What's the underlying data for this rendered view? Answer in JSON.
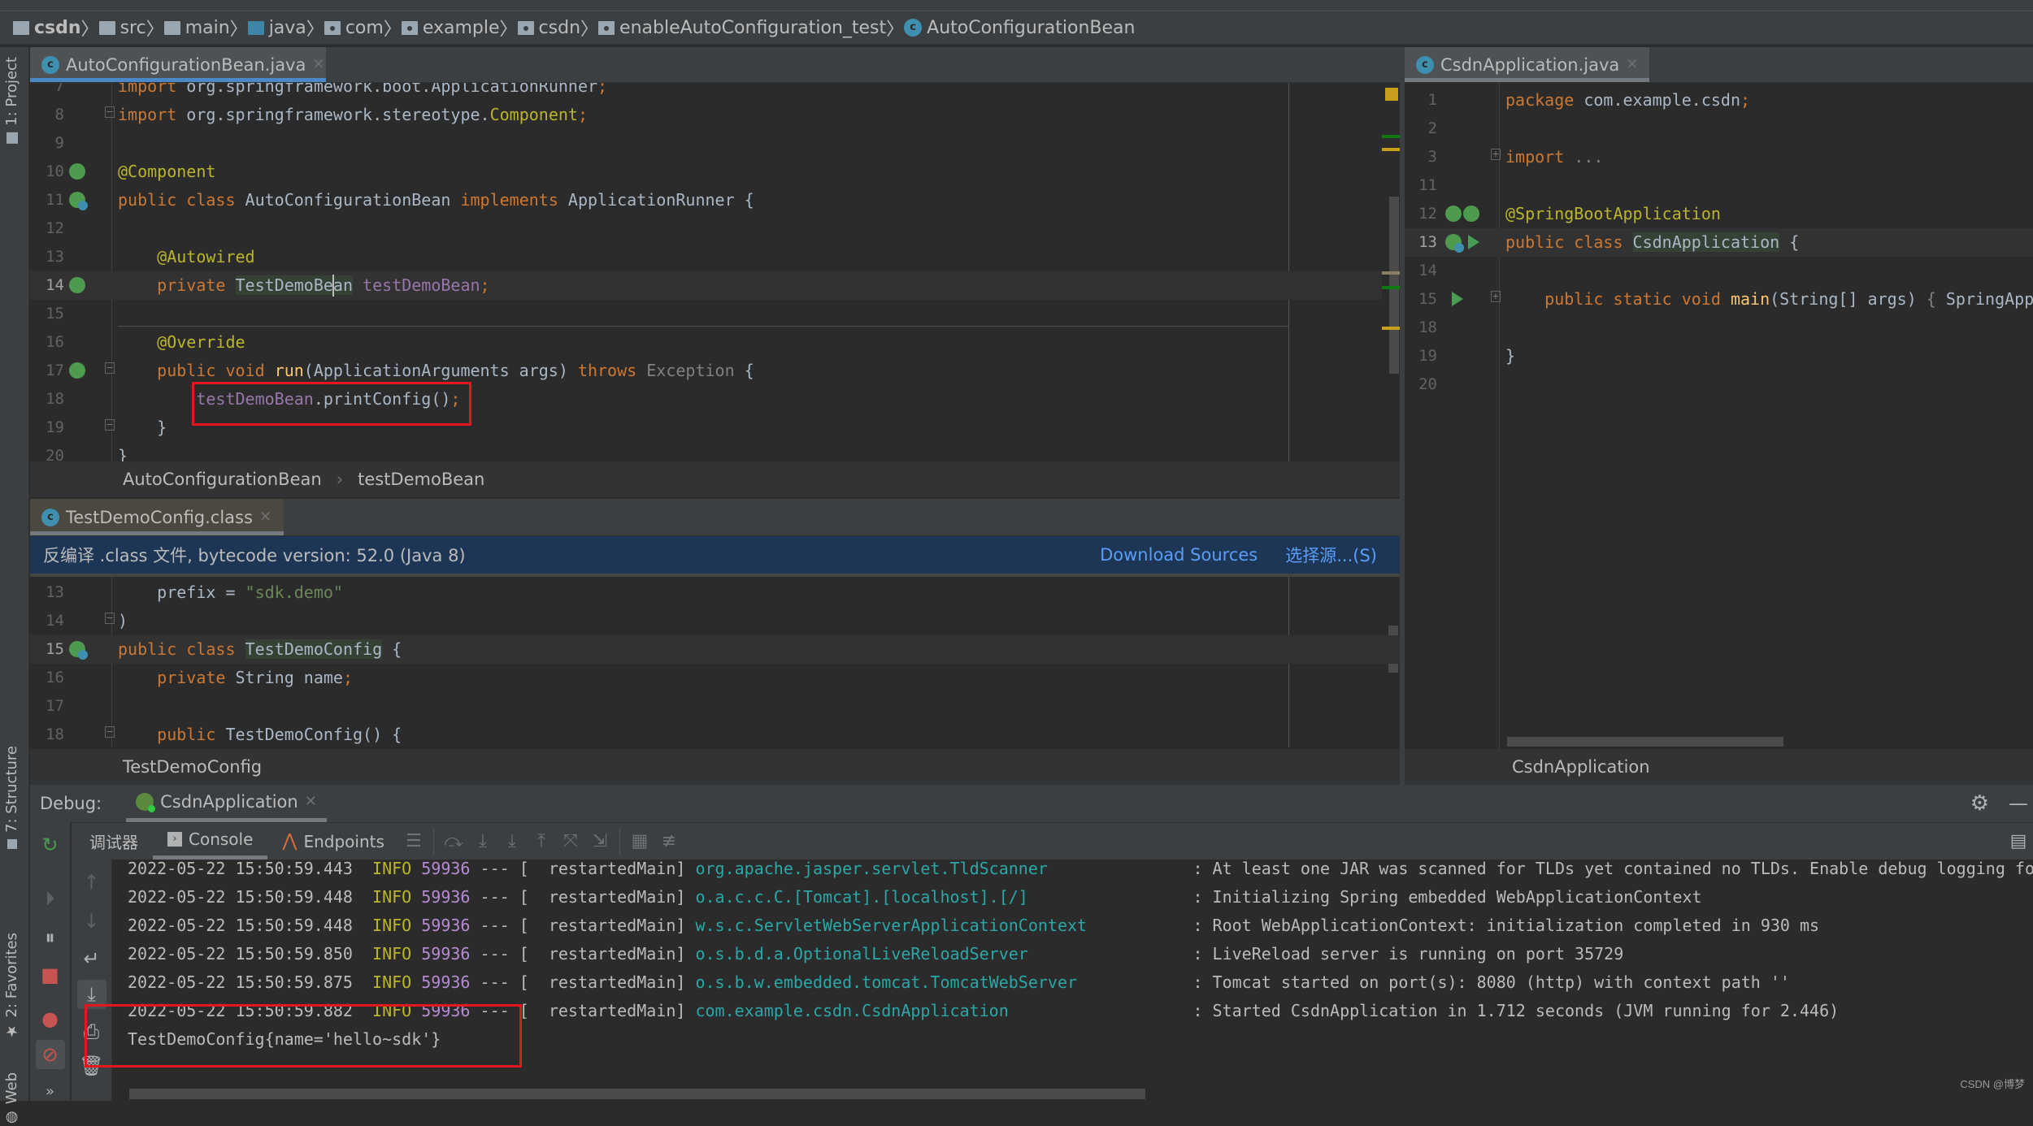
{
  "breadcrumb": [
    {
      "label": "csdn",
      "type": "module"
    },
    {
      "label": "src",
      "type": "folder"
    },
    {
      "label": "main",
      "type": "folder"
    },
    {
      "label": "java",
      "type": "source-folder"
    },
    {
      "label": "com",
      "type": "package"
    },
    {
      "label": "example",
      "type": "package"
    },
    {
      "label": "csdn",
      "type": "package"
    },
    {
      "label": "enableAutoConfiguration_test",
      "type": "package"
    },
    {
      "label": "AutoConfigurationBean",
      "type": "class"
    }
  ],
  "left_tool_strip": {
    "project": "1: Project",
    "structure": "7: Structure",
    "favorites": "2: Favorites",
    "web": "Web"
  },
  "editor_top": {
    "tab": "AutoConfigurationBean.java",
    "lines": [
      {
        "n": "7",
        "tokens": [
          [
            "kw",
            "import "
          ],
          [
            "typ",
            "org.springframework.boot.ApplicationRunner"
          ],
          [
            "sem",
            ";"
          ]
        ]
      },
      {
        "n": "8",
        "tokens": [
          [
            "kw",
            "import "
          ],
          [
            "typ",
            "org.springframework.stereotype."
          ],
          [
            "ann",
            "Component"
          ],
          [
            "sem",
            ";"
          ]
        ]
      },
      {
        "n": "9",
        "tokens": []
      },
      {
        "n": "10",
        "tokens": [
          [
            "ann",
            "@Component"
          ]
        ]
      },
      {
        "n": "11",
        "tokens": [
          [
            "kw",
            "public class "
          ],
          [
            "typ",
            "AutoConfigurationBean "
          ],
          [
            "kw",
            "implements "
          ],
          [
            "typ",
            "ApplicationRunner {"
          ]
        ]
      },
      {
        "n": "12",
        "tokens": []
      },
      {
        "n": "13",
        "tokens": [
          [
            "ann",
            "    @Autowired"
          ]
        ]
      },
      {
        "n": "14",
        "tokens": [
          [
            "kw",
            "    private "
          ],
          [
            "typ",
            "TestDemoBean"
          ],
          [
            "typ",
            " "
          ],
          [
            "fld",
            "testDemoBean"
          ],
          [
            "sem",
            ";"
          ]
        ]
      },
      {
        "n": "15",
        "tokens": []
      },
      {
        "n": "16",
        "tokens": [
          [
            "ann",
            "    @Override"
          ]
        ]
      },
      {
        "n": "17",
        "tokens": [
          [
            "kw",
            "    public void "
          ],
          [
            "fn",
            "run"
          ],
          [
            "typ",
            "(ApplicationArguments args) "
          ],
          [
            "kw",
            "throws "
          ],
          [
            "gray",
            "Exception "
          ],
          [
            "typ",
            "{"
          ]
        ]
      },
      {
        "n": "18",
        "tokens": [
          [
            "typ",
            "        "
          ],
          [
            "fld",
            "testDemoBean"
          ],
          [
            "typ",
            ".printConfig()"
          ],
          [
            "sem",
            ";"
          ]
        ]
      },
      {
        "n": "19",
        "tokens": [
          [
            "typ",
            "    }"
          ]
        ]
      },
      {
        "n": "20",
        "tokens": [
          [
            "typ",
            "}"
          ]
        ]
      }
    ],
    "nav_breadcrumb": [
      "AutoConfigurationBean",
      "testDemoBean"
    ]
  },
  "editor_right": {
    "tab": "CsdnApplication.java",
    "lines": [
      {
        "n": "1",
        "tokens": [
          [
            "kw",
            "package "
          ],
          [
            "typ",
            "com.example.csdn"
          ],
          [
            "sem",
            ";"
          ]
        ]
      },
      {
        "n": "2",
        "tokens": []
      },
      {
        "n": "3",
        "tokens": [
          [
            "kw",
            "import "
          ],
          [
            "gray",
            "..."
          ]
        ]
      },
      {
        "n": "11",
        "tokens": []
      },
      {
        "n": "12",
        "tokens": [
          [
            "ann",
            "@SpringBootApplication"
          ]
        ]
      },
      {
        "n": "13",
        "tokens": [
          [
            "kw",
            "public class "
          ],
          [
            "typ",
            "CsdnApplication"
          ],
          [
            "typ",
            " {"
          ]
        ]
      },
      {
        "n": "14",
        "tokens": []
      },
      {
        "n": "15",
        "tokens": [
          [
            "kw",
            "    public static void "
          ],
          [
            "fn",
            "main"
          ],
          [
            "typ",
            "(String[] args) "
          ],
          [
            "gray",
            "{ "
          ],
          [
            "typ",
            "SpringApp"
          ]
        ]
      },
      {
        "n": "18",
        "tokens": []
      },
      {
        "n": "19",
        "tokens": [
          [
            "typ",
            "}"
          ]
        ]
      },
      {
        "n": "20",
        "tokens": []
      }
    ],
    "nav_breadcrumb": "CsdnApplication"
  },
  "editor_bottom": {
    "tab": "TestDemoConfig.class",
    "banner_text": "反编译 .class 文件, bytecode version: 52.0 (Java 8)",
    "download_sources": "Download Sources",
    "choose_sources": "选择源...(S)",
    "lines": [
      {
        "n": "13",
        "tokens": [
          [
            "typ",
            "    prefix = "
          ],
          [
            "str",
            "\"sdk.demo\""
          ]
        ]
      },
      {
        "n": "14",
        "tokens": [
          [
            "typ",
            ")"
          ]
        ]
      },
      {
        "n": "15",
        "tokens": [
          [
            "kw",
            "public class "
          ],
          [
            "typ",
            "TestDemoConfig"
          ],
          [
            "typ",
            " {"
          ]
        ]
      },
      {
        "n": "16",
        "tokens": [
          [
            "kw",
            "    private "
          ],
          [
            "typ",
            "String name"
          ],
          [
            "sem",
            ";"
          ]
        ]
      },
      {
        "n": "17",
        "tokens": []
      },
      {
        "n": "18",
        "tokens": [
          [
            "kw",
            "    public "
          ],
          [
            "typ",
            "TestDemoConfig() {"
          ]
        ]
      }
    ],
    "nav_breadcrumb": "TestDemoConfig"
  },
  "debug": {
    "label": "Debug:",
    "session_tab": "CsdnApplication",
    "tabs": {
      "debugger": "调试器",
      "console": "Console",
      "endpoints": "Endpoints"
    },
    "console_lines": [
      {
        "ts": "2022-05-22 15:50:59.443",
        "level": "INFO",
        "pid": "59936",
        "sep": "---",
        "thread": "[  restartedMain]",
        "logger": "org.apache.jasper.servlet.TldScanner",
        "msg": ": At least one JAR was scanned for TLDs yet contained no TLDs. Enable debug logging for this log"
      },
      {
        "ts": "2022-05-22 15:50:59.448",
        "level": "INFO",
        "pid": "59936",
        "sep": "---",
        "thread": "[  restartedMain]",
        "logger": "o.a.c.c.C.[Tomcat].[localhost].[/]",
        "msg": ": Initializing Spring embedded WebApplicationContext"
      },
      {
        "ts": "2022-05-22 15:50:59.448",
        "level": "INFO",
        "pid": "59936",
        "sep": "---",
        "thread": "[  restartedMain]",
        "logger": "w.s.c.ServletWebServerApplicationContext",
        "msg": ": Root WebApplicationContext: initialization completed in 930 ms"
      },
      {
        "ts": "2022-05-22 15:50:59.850",
        "level": "INFO",
        "pid": "59936",
        "sep": "---",
        "thread": "[  restartedMain]",
        "logger": "o.s.b.d.a.OptionalLiveReloadServer",
        "msg": ": LiveReload server is running on port 35729"
      },
      {
        "ts": "2022-05-22 15:50:59.875",
        "level": "INFO",
        "pid": "59936",
        "sep": "---",
        "thread": "[  restartedMain]",
        "logger": "o.s.b.w.embedded.tomcat.TomcatWebServer",
        "msg": ": Tomcat started on port(s): 8080 (http) with context path ''"
      },
      {
        "ts": "2022-05-22 15:50:59.882",
        "level": "INFO",
        "pid": "59936",
        "sep": "---",
        "thread": "[  restartedMain]",
        "logger": "com.example.csdn.CsdnApplication",
        "msg": ": Started CsdnApplication in 1.712 seconds (JVM running for 2.446)"
      }
    ],
    "output_line": "TestDemoConfig{name='hello~sdk'}"
  },
  "watermark": "CSDN @博梦",
  "colors": {
    "accent": "#4a88c7",
    "highlight_box": "#e3171e",
    "banner_bg": "#1e3656",
    "link": "#589df6"
  }
}
